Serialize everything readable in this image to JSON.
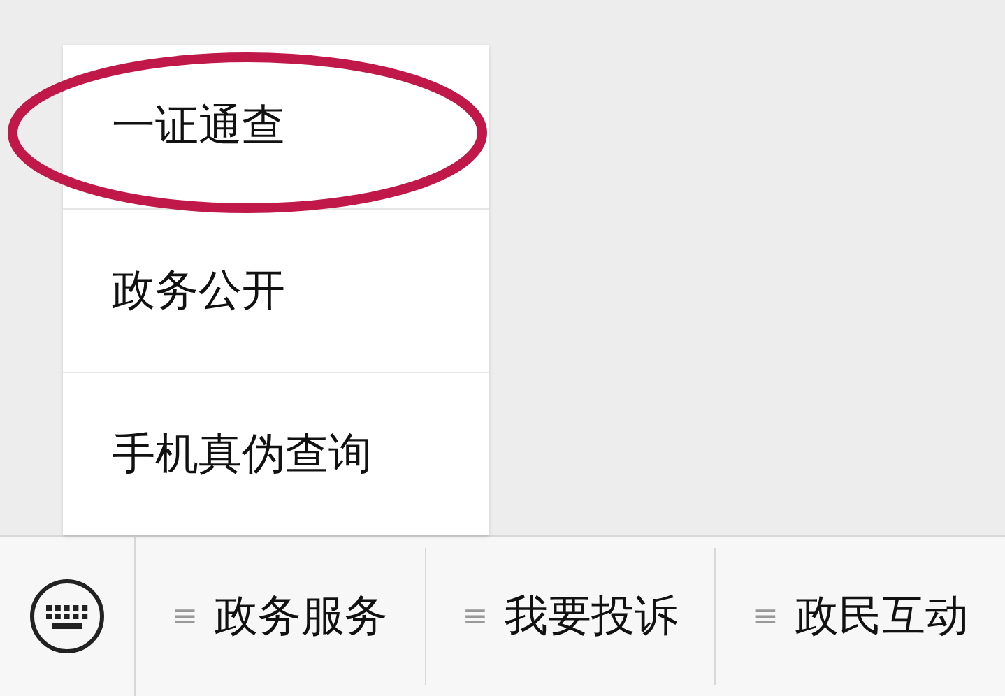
{
  "popup_menu": {
    "items": [
      {
        "label": "一证通查",
        "highlighted": true
      },
      {
        "label": "政务公开",
        "highlighted": false
      },
      {
        "label": "手机真伪查询",
        "highlighted": false
      }
    ]
  },
  "bottom_bar": {
    "menus": [
      {
        "icon": "≡",
        "label": "政务服务"
      },
      {
        "icon": "≡",
        "label": "我要投诉"
      },
      {
        "icon": "≡",
        "label": "政民互动"
      }
    ]
  }
}
